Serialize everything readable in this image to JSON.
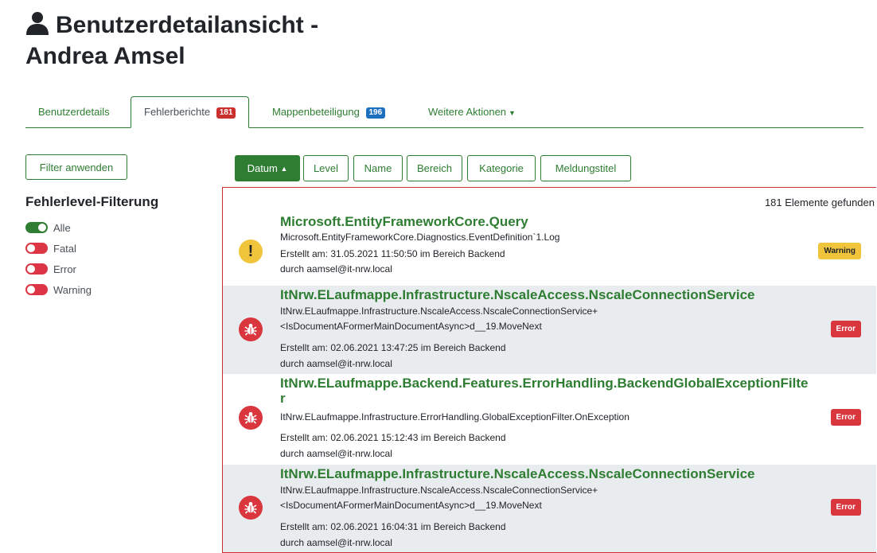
{
  "page": {
    "title_line1": "Benutzerdetailansicht -",
    "title_line2": "Andrea Amsel"
  },
  "tabs": [
    {
      "label": "Benutzerdetails"
    },
    {
      "label": "Fehlerberichte",
      "badge": "181",
      "badge_color": "#c9302c"
    },
    {
      "label": "Mappenbeteiligung",
      "badge": "196",
      "badge_color": "#1f6fbf"
    },
    {
      "label": "Weitere Aktionen"
    }
  ],
  "filter": {
    "apply_label": "Filter anwenden",
    "heading": "Fehlerlevel-Filterung",
    "toggles": [
      {
        "label": "Alle",
        "state": "on"
      },
      {
        "label": "Fatal",
        "state": "off"
      },
      {
        "label": "Error",
        "state": "off"
      },
      {
        "label": "Warning",
        "state": "off"
      }
    ]
  },
  "sort_buttons": [
    {
      "label": "Datum",
      "active": true,
      "sort": "asc"
    },
    {
      "label": "Level"
    },
    {
      "label": "Name"
    },
    {
      "label": "Bereich"
    },
    {
      "label": "Kategorie"
    },
    {
      "label": "Meldungstitel"
    }
  ],
  "results": {
    "count_text": "181 Elemente gefunden",
    "entries": [
      {
        "title": "Microsoft.EntityFrameworkCore.Query",
        "source": "Microsoft.EntityFrameworkCore.Diagnostics.EventDefinition`1.Log",
        "created": "Erstellt am: 31.05.2021 11:50:50 im Bereich Backend",
        "by": "durch aamsel@it-nrw.local",
        "level": "Warning",
        "icon": "exclamation-icon"
      },
      {
        "title": "ItNrw.ELaufmappe.Infrastructure.NscaleAccess.NscaleConnectionService",
        "source_line1": "ItNrw.ELaufmappe.Infrastructure.NscaleAccess.NscaleConnectionService+",
        "source_line2": "<IsDocumentAFormerMainDocumentAsync>d__19.MoveNext",
        "created": "Erstellt am: 02.06.2021 13:47:25 im Bereich Backend",
        "by": "durch aamsel@it-nrw.local",
        "level": "Error",
        "icon": "bug-icon"
      },
      {
        "title_line1": "ItNrw.ELaufmappe.Backend.Features.ErrorHandling.BackendGlobalExceptionFilte",
        "title_line2": "r",
        "source": "ItNrw.ELaufmappe.Infrastructure.ErrorHandling.GlobalExceptionFilter.OnException",
        "created": "Erstellt am: 02.06.2021 15:12:43 im Bereich Backend",
        "by": "durch aamsel@it-nrw.local",
        "level": "Error",
        "icon": "bug-icon"
      },
      {
        "title": "ItNrw.ELaufmappe.Infrastructure.NscaleAccess.NscaleConnectionService",
        "source_line1": "ItNrw.ELaufmappe.Infrastructure.NscaleAccess.NscaleConnectionService+",
        "source_line2": "<IsDocumentAFormerMainDocumentAsync>d__19.MoveNext",
        "created": "Erstellt am: 02.06.2021 16:04:31 im Bereich Backend",
        "by": "durch aamsel@it-nrw.local",
        "level": "Error",
        "icon": "bug-icon"
      }
    ]
  },
  "colors": {
    "primary": "#2e7d32",
    "error": "#d9363e",
    "warning": "#f0c53c"
  }
}
